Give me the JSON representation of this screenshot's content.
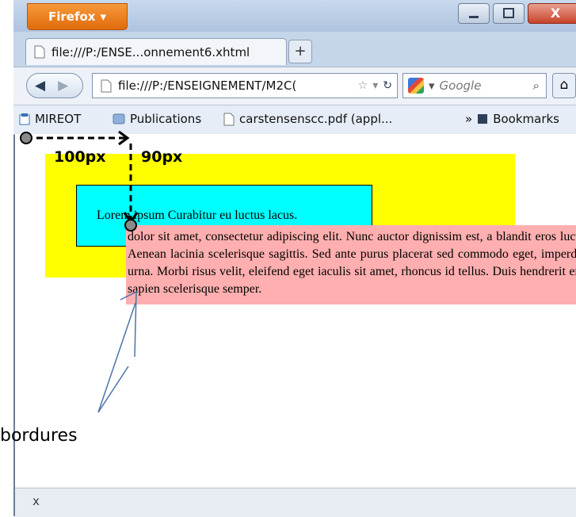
{
  "window": {
    "app_button_label": "Firefox",
    "close_glyph": "X"
  },
  "tab": {
    "title": "file:///P:/ENSE...onnement6.xhtml",
    "new_tab_glyph": "+"
  },
  "navbar": {
    "url": "file:///P:/ENSEIGNEMENT/M2C(",
    "search_placeholder": "Google"
  },
  "bookmarks": {
    "items": [
      "MIREOT",
      "Publications",
      "carstensenscc.pdf (appl..."
    ],
    "overflow_label": "»",
    "bookmarks_menu": "Bookmarks"
  },
  "content": {
    "cyan_text": "Lorem ipsum Curabitur eu luctus lacus.",
    "pink_text": "dolor sit amet, consectetur adipiscing elit. Nunc auctor dignissim est, a blandit eros luctus a. Aenean lacinia scelerisque sagittis. Sed ante purus placerat sed commodo eget, imperdiet et urna. Morbi risus velit, eleifend eget iaculis sit amet, rhoncus id tellus. Duis hendrerit eros at sapien scelerisque semper.",
    "colors": {
      "outer_box": "#ffff00",
      "inner_box": "#00ffff",
      "floating_box": "#ffafaf"
    }
  },
  "annotations": {
    "horizontal_label": "100px",
    "vertical_label": "90px",
    "callout_label": "bordures"
  },
  "statusbar": {
    "close_glyph": "x"
  }
}
